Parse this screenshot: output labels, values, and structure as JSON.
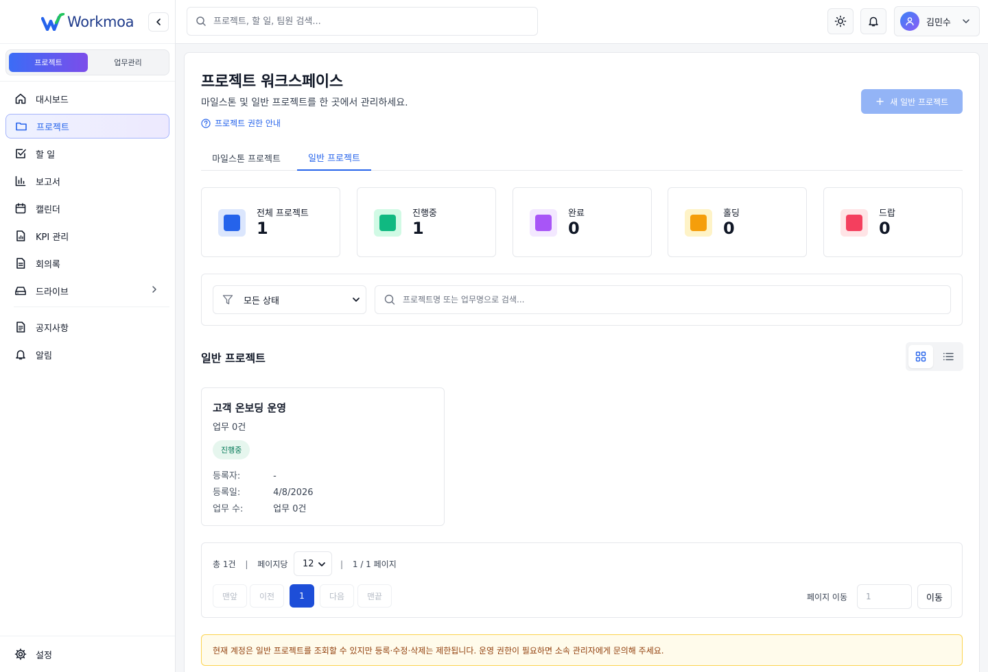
{
  "app": {
    "logo_text": "Workmoa"
  },
  "sidebar": {
    "modes": [
      "프로젝트",
      "업무관리"
    ],
    "items": [
      {
        "label": "대시보드",
        "icon": "home-icon"
      },
      {
        "label": "프로젝트",
        "icon": "folder-icon",
        "active": true
      },
      {
        "label": "할 일",
        "icon": "checkbox-icon"
      },
      {
        "label": "보고서",
        "icon": "bar-chart-icon"
      },
      {
        "label": "캘린더",
        "icon": "calendar-icon"
      },
      {
        "label": "KPI 관리",
        "icon": "file-chart-icon"
      },
      {
        "label": "회의록",
        "icon": "document-icon"
      },
      {
        "label": "드라이브",
        "icon": "drive-icon"
      }
    ],
    "secondary": [
      {
        "label": "공지사항",
        "icon": "notice-icon"
      },
      {
        "label": "알림",
        "icon": "bell-icon"
      }
    ],
    "settings_label": "설정"
  },
  "topbar": {
    "search_placeholder": "프로젝트, 할 일, 팀원 검색...",
    "user_name": "김민수"
  },
  "page": {
    "title": "프로젝트 워크스페이스",
    "subtitle": "마일스톤 및 일반 프로젝트를 한 곳에서 관리하세요.",
    "perm_link": "프로젝트 권한 안내",
    "new_button": "새 일반 프로젝트",
    "tabs": [
      "마일스톤 프로젝트",
      "일반 프로젝트"
    ],
    "active_tab": 1
  },
  "stats": [
    {
      "label": "전체 프로젝트",
      "value": "1",
      "color": "#2563eb",
      "bg": "#dbe6fd"
    },
    {
      "label": "진행중",
      "value": "1",
      "color": "#10b981",
      "bg": "#d1fae5"
    },
    {
      "label": "완료",
      "value": "0",
      "color": "#a855f7",
      "bg": "#f3e8ff"
    },
    {
      "label": "홀딩",
      "value": "0",
      "color": "#f59e0b",
      "bg": "#fef3c7"
    },
    {
      "label": "드랍",
      "value": "0",
      "color": "#f43f5e",
      "bg": "#ffe4e6"
    }
  ],
  "filter": {
    "status_value": "모든 상태",
    "search_placeholder": "프로젝트명 또는 업무명으로 검색..."
  },
  "section": {
    "title": "일반 프로젝트"
  },
  "projects": [
    {
      "name": "고객 온보딩 운영",
      "tasks": "업무 0건",
      "status": "진행중",
      "meta": [
        {
          "key": "등록자:",
          "value": "-"
        },
        {
          "key": "등록일:",
          "value": "4/8/2026"
        },
        {
          "key": "업무 수:",
          "value": "업무 0건"
        }
      ]
    }
  ],
  "pager": {
    "total": "총 1건",
    "sep": "|",
    "per_page_label": "페이지당",
    "per_page": "12",
    "page_info": "1 / 1 페이지",
    "first": "맨앞",
    "prev": "이전",
    "current": "1",
    "next": "다음",
    "last": "맨끝",
    "jump_label": "페이지 이동",
    "jump_placeholder": "1",
    "jump_button": "이동"
  },
  "notice": "현재 계정은 일반 프로젝트를 조회할 수 있지만 등록·수정·삭제는 제한됩니다. 운영 권한이 필요하면 소속 관리자에게 문의해 주세요."
}
